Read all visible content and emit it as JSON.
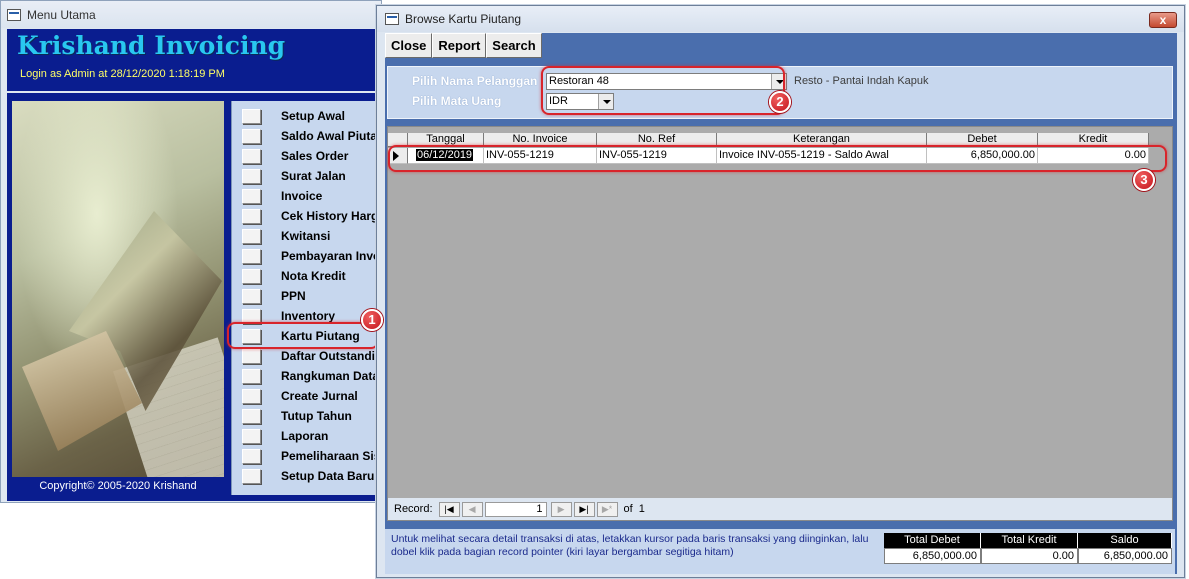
{
  "menu_window": {
    "title": "Menu Utama",
    "app_name": "Krishand Invoicing",
    "login_info": "Login as Admin at 28/12/2020 1:18:19 PM",
    "copyright": "Copyright© 2005-2020 Krishand",
    "items": [
      {
        "label": "Setup Awal"
      },
      {
        "label": "Saldo Awal Piutang"
      },
      {
        "label": "Sales Order"
      },
      {
        "label": "Surat Jalan"
      },
      {
        "label": "Invoice"
      },
      {
        "label": "Cek History Harga"
      },
      {
        "label": "Kwitansi"
      },
      {
        "label": "Pembayaran Invoice"
      },
      {
        "label": "Nota Kredit"
      },
      {
        "label": "PPN"
      },
      {
        "label": "Inventory"
      },
      {
        "label": "Kartu Piutang"
      },
      {
        "label": "Daftar Outstanding"
      },
      {
        "label": "Rangkuman Data"
      },
      {
        "label": "Create Jurnal"
      },
      {
        "label": "Tutup Tahun"
      },
      {
        "label": "Laporan"
      },
      {
        "label": "Pemeliharaan Sistem"
      },
      {
        "label": "Setup Data Baru"
      }
    ]
  },
  "browse_window": {
    "title": "Browse Kartu Piutang",
    "close_glyph": "x",
    "toolbar": {
      "close": "Close",
      "report": "Report",
      "search": "Search"
    },
    "filter": {
      "customer_label": "Pilih Nama Pelanggan",
      "customer_value": "Restoran 48",
      "customer_desc": "Resto - Pantai Indah Kapuk",
      "currency_label": "Pilih Mata Uang",
      "currency_value": "IDR"
    },
    "grid": {
      "columns": [
        "Tanggal",
        "No. Invoice",
        "No. Ref",
        "Keterangan",
        "Debet",
        "Kredit"
      ],
      "rows": [
        {
          "tanggal": "06/12/2019",
          "no_invoice": "INV-055-1219",
          "no_ref": "INV-055-1219",
          "keterangan": "Invoice INV-055-1219 - Saldo Awal",
          "debet": "6,850,000.00",
          "kredit": "0.00"
        }
      ]
    },
    "navigation": {
      "record_label": "Record:",
      "current": "1",
      "of_label": "of",
      "total": "1"
    },
    "footer_note": "Untuk melihat secara detail transaksi di atas, letakkan kursor pada baris transaksi yang diinginkan, lalu dobel klik pada bagian record pointer (kiri layar bergambar segitiga hitam)",
    "totals": {
      "debet_label": "Total Debet",
      "kredit_label": "Total Kredit",
      "saldo_label": "Saldo",
      "debet": "6,850,000.00",
      "kredit": "0.00",
      "saldo": "6,850,000.00"
    }
  },
  "callouts": [
    "1",
    "2",
    "3"
  ],
  "colors": {
    "header_navy": "#0a1d8f",
    "title_cyan": "#29c7f0",
    "login_yellow": "#ffff66",
    "panel_blue": "#c7d7ee",
    "frame_blue": "#4a6ead",
    "callout_red": "#d8242b"
  }
}
